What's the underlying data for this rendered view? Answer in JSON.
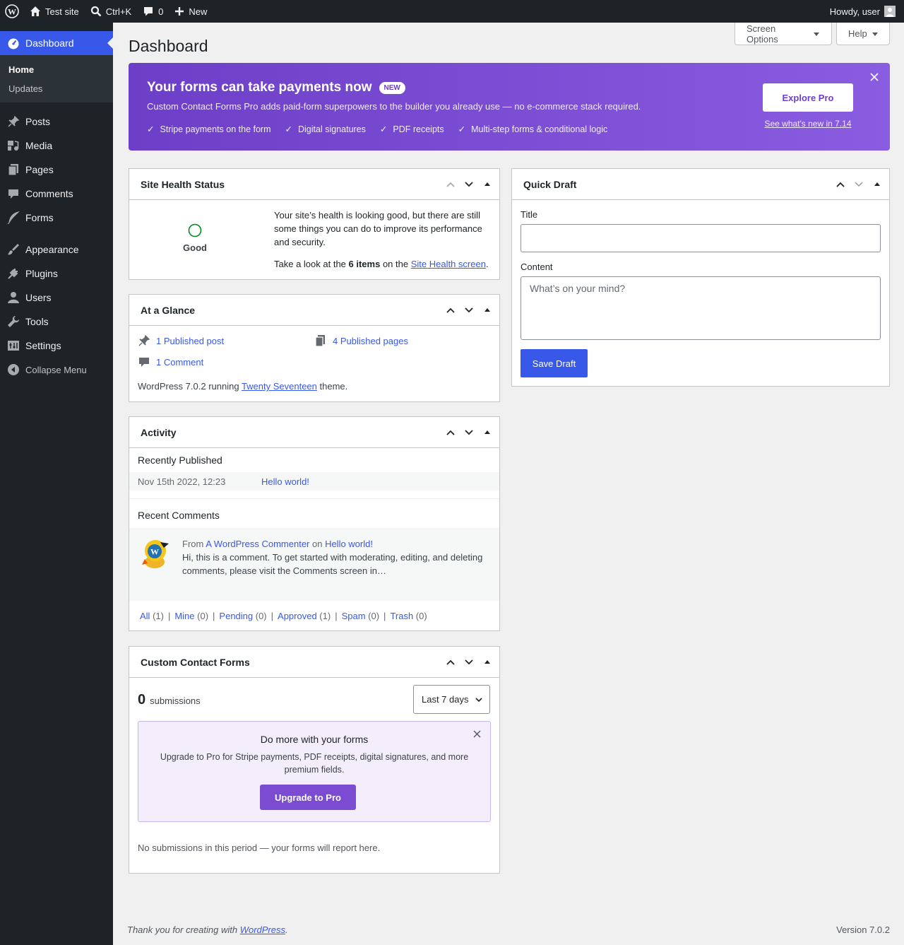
{
  "adminbar": {
    "site": "Test site",
    "search": "Ctrl+K",
    "comments": "0",
    "new": "New",
    "howdy": "Howdy, user"
  },
  "sidebar": {
    "dashboard": "Dashboard",
    "home": "Home",
    "updates": "Updates",
    "items": [
      {
        "label": "Posts",
        "icon": "pin-icon"
      },
      {
        "label": "Media",
        "icon": "media-icon"
      },
      {
        "label": "Pages",
        "icon": "pages-icon"
      },
      {
        "label": "Comments",
        "icon": "comment-icon"
      },
      {
        "label": "Forms",
        "icon": "feather-icon"
      },
      {
        "label": "Appearance",
        "icon": "brush-icon"
      },
      {
        "label": "Plugins",
        "icon": "plug-icon"
      },
      {
        "label": "Users",
        "icon": "user-icon"
      },
      {
        "label": "Tools",
        "icon": "wrench-icon"
      },
      {
        "label": "Settings",
        "icon": "settings-icon"
      }
    ],
    "collapse": "Collapse Menu"
  },
  "header": {
    "title": "Dashboard",
    "screen_options": "Screen Options",
    "help": "Help"
  },
  "banner": {
    "title": "Your forms can take payments now",
    "badge": "NEW",
    "desc": "Custom Contact Forms Pro adds paid-form superpowers to the builder you already use — no e-commerce stack required.",
    "features": [
      "Stripe payments on the form",
      "Digital signatures",
      "PDF receipts",
      "Multi-step forms & conditional logic"
    ],
    "cta": "Explore Pro",
    "whats_new": "See what's new in 7.14",
    "check": "✓"
  },
  "site_health": {
    "title": "Site Health Status",
    "status": "Good",
    "text": "Your site’s health is looking good, but there are still some things you can do to improve its performance and security.",
    "prefix": "Take a look at the ",
    "items": "6 items",
    "mid": " on the ",
    "link": "Site Health screen",
    "suffix": "."
  },
  "glance": {
    "title": "At a Glance",
    "posts": "1 Published post",
    "pages": "4 Published pages",
    "comments": "1 Comment",
    "wp_prefix": "WordPress 7.0.2 running ",
    "theme": "Twenty Seventeen",
    "wp_suffix": " theme."
  },
  "activity": {
    "title": "Activity",
    "recently_published": "Recently Published",
    "pub_date": "Nov 15th 2022, 12:23",
    "pub_title": "Hello world!",
    "recent_comments": "Recent Comments",
    "from": "From ",
    "commenter": "A WordPress Commenter",
    "on": " on ",
    "comment_post": "Hello world!",
    "comment_text": "Hi, this is a comment. To get started with moderating, editing, and deleting comments, please visit the Comments screen in…",
    "filters": [
      {
        "label": "All",
        "count": " (1)"
      },
      {
        "label": "Mine",
        "count": " (0)"
      },
      {
        "label": "Pending",
        "count": " (0)"
      },
      {
        "label": "Approved",
        "count": " (1)"
      },
      {
        "label": "Spam",
        "count": " (0)"
      },
      {
        "label": "Trash",
        "count": " (0)"
      }
    ],
    "sep": "|"
  },
  "ccf": {
    "title": "Custom Contact Forms",
    "count": "0",
    "submissions": "submissions",
    "range": "Last 7 days",
    "promo_title": "Do more with your forms",
    "promo_text": "Upgrade to Pro for Stripe payments, PDF receipts, digital signatures, and more premium fields.",
    "upgrade": "Upgrade to Pro",
    "empty": "No submissions in this period — your forms will report here."
  },
  "quick_draft": {
    "title": "Quick Draft",
    "title_label": "Title",
    "title_value": "",
    "content_label": "Content",
    "content_placeholder": "What’s on your mind?",
    "save": "Save Draft"
  },
  "footer": {
    "thanks": "Thank you for creating with ",
    "wp": "WordPress",
    "dot": ".",
    "version": "Version 7.0.2"
  },
  "colors": {
    "accent": "#3858e9",
    "promo": "#6d3fc8",
    "good": "#008a20"
  }
}
